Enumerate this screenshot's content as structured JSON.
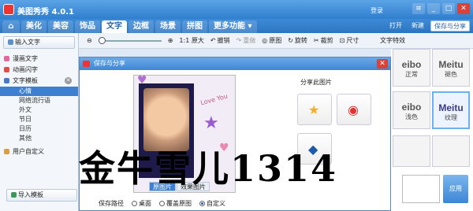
{
  "app": {
    "title": "美图秀秀 4.0.1",
    "login": "登录"
  },
  "tabs": [
    "美化",
    "美容",
    "饰品",
    "文字",
    "边框",
    "场景",
    "拼图",
    "更多功能 ▾"
  ],
  "active_tab": "文字",
  "header_actions": {
    "open": "打开",
    "new": "新建",
    "save_share": "保存与分享"
  },
  "toolbar": {
    "actual_size": "1:1 原大",
    "undo": "撤销",
    "redo": "重做",
    "original": "原图",
    "rotate": "旋转",
    "crop": "裁剪",
    "resize": "尺寸"
  },
  "sidebar": {
    "input_text": "输入文字",
    "comic_text": "漫画文字",
    "animated_text": "动画闪字",
    "templates": "文字模板",
    "sub_items": [
      "心情",
      "网络流行语",
      "外文",
      "节日",
      "日历",
      "其他"
    ],
    "active_sub": "心情",
    "custom": "用户自定义",
    "import": "导入模板"
  },
  "effects": {
    "title": "文字特效",
    "items": [
      {
        "image_text": "eibo",
        "label": "正常"
      },
      {
        "image_text": "Meitu",
        "label": "褪色"
      },
      {
        "image_text": "eibo",
        "label": "浅色"
      },
      {
        "image_text": "Meitu",
        "label": "纹理"
      }
    ],
    "selected_label": "纹理",
    "apply": "应用"
  },
  "dialog": {
    "title": "保存与分享",
    "preview_tabs": [
      "原图片",
      "效果图片"
    ],
    "active_preview_tab": "原图片",
    "love_text": "Love You",
    "share_label": "分享此图片",
    "save_path_label": "保存路径",
    "save_options": [
      "桌面",
      "覆盖原图",
      "自定义"
    ],
    "selected_option": "自定义"
  },
  "watermark": "金牛雪儿1314",
  "colors": {
    "title_bar": "#2f7fcf",
    "active_tab_text": "#2364a8",
    "dialog_title": "#3f86d3"
  }
}
